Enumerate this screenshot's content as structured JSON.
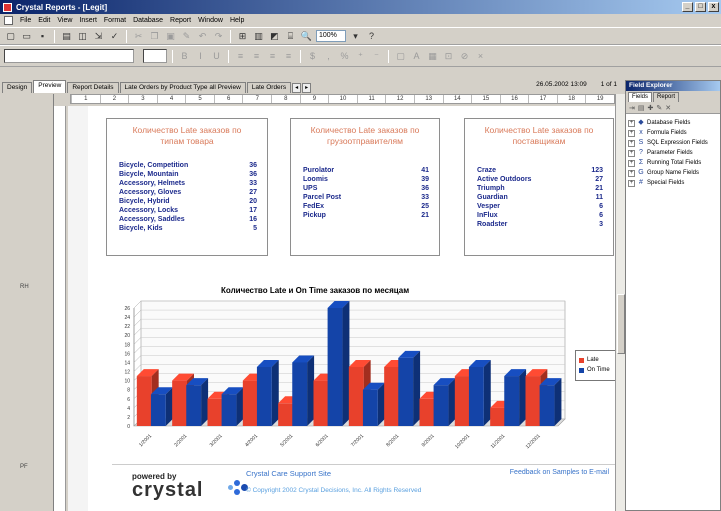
{
  "window": {
    "title": "Crystal Reports - [Legit]",
    "buttons": [
      "_",
      "□",
      "x"
    ]
  },
  "menu": [
    "File",
    "Edit",
    "View",
    "Insert",
    "Format",
    "Database",
    "Report",
    "Window",
    "Help"
  ],
  "toolbar": {
    "zoom": "100%"
  },
  "tabs": [
    {
      "label": "Design",
      "active": false
    },
    {
      "label": "Preview",
      "active": true
    },
    {
      "label": "Report Details",
      "active": false
    },
    {
      "label": "Late Orders by Product Type all Preview",
      "active": false
    },
    {
      "label": "Late Orders",
      "active": false
    }
  ],
  "status": {
    "datetime": "26.05.2002 13:09",
    "page": "1 of 1"
  },
  "ruler": [
    "1",
    "2",
    "3",
    "4",
    "5",
    "6",
    "7",
    "8",
    "9",
    "10",
    "11",
    "12",
    "13",
    "14",
    "15",
    "16",
    "17",
    "18",
    "19"
  ],
  "sections": {
    "rh": "RH",
    "pf": "PF"
  },
  "report": {
    "box1": {
      "title": "Количество Late заказов по типам товара",
      "rows": [
        {
          "name": "Bicycle, Competition",
          "value": "36"
        },
        {
          "name": "Bicycle, Mountain",
          "value": "36"
        },
        {
          "name": "Accessory, Helmets",
          "value": "33"
        },
        {
          "name": "Accessory, Gloves",
          "value": "27"
        },
        {
          "name": "Bicycle, Hybrid",
          "value": "20"
        },
        {
          "name": "Accessory, Locks",
          "value": "17"
        },
        {
          "name": "Accessory, Saddles",
          "value": "16"
        },
        {
          "name": "Bicycle, Kids",
          "value": "5"
        }
      ]
    },
    "box2": {
      "title": "Количество Late заказов по грузоотправителям",
      "rows": [
        {
          "name": "Purolator",
          "value": "41"
        },
        {
          "name": "Loomis",
          "value": "39"
        },
        {
          "name": "UPS",
          "value": "36"
        },
        {
          "name": "Parcel Post",
          "value": "33"
        },
        {
          "name": "FedEx",
          "value": "25"
        },
        {
          "name": "Pickup",
          "value": "21"
        }
      ]
    },
    "box3": {
      "title": "Количество Late заказов по поставщикам",
      "rows": [
        {
          "name": "Craze",
          "value": "123"
        },
        {
          "name": "Active Outdoors",
          "value": "27"
        },
        {
          "name": "Triumph",
          "value": "21"
        },
        {
          "name": "Guardian",
          "value": "11"
        },
        {
          "name": "Vesper",
          "value": "6"
        },
        {
          "name": "InFlux",
          "value": "6"
        },
        {
          "name": "Roadster",
          "value": "3"
        }
      ]
    }
  },
  "chart_data": {
    "type": "bar",
    "title": "Количество Late и On Time заказов по месяцам",
    "categories": [
      "1/2001",
      "2/2001",
      "3/2001",
      "4/2001",
      "5/2001",
      "6/2001",
      "7/2001",
      "8/2001",
      "9/2001",
      "10/2001",
      "11/2001",
      "12/2001"
    ],
    "series": [
      {
        "name": "Late",
        "color": "#e8412c",
        "values": [
          11,
          10,
          6,
          10,
          5,
          10,
          13,
          13,
          6,
          11,
          4,
          11
        ]
      },
      {
        "name": "On Time",
        "color": "#1444a8",
        "values": [
          7,
          9,
          7,
          13,
          14,
          26,
          8,
          15,
          9,
          13,
          11,
          9
        ]
      }
    ],
    "yticks": [
      "0",
      "2",
      "4",
      "6",
      "8",
      "10",
      "12",
      "14",
      "16",
      "18",
      "20",
      "22",
      "24",
      "26"
    ],
    "ylim": [
      0,
      26
    ],
    "legend": "right",
    "grid": true
  },
  "footer": {
    "powered": "powered by",
    "brand": "crystal",
    "support": "Crystal Care Support Site",
    "copyright": "© Copyright 2002 Crystal Decisions, Inc. All Rights Reserved",
    "feedback": "Feedback on Samples to E-mail"
  },
  "explorer": {
    "title": "Field Explorer",
    "tabs": [
      "Fields",
      "Report"
    ],
    "items": [
      {
        "label": "Database Fields",
        "icon": "◆"
      },
      {
        "label": "Formula Fields",
        "icon": "x"
      },
      {
        "label": "SQL Expression Fields",
        "icon": "S"
      },
      {
        "label": "Parameter Fields",
        "icon": "?"
      },
      {
        "label": "Running Total Fields",
        "icon": "Σ"
      },
      {
        "label": "Group Name Fields",
        "icon": "G"
      },
      {
        "label": "Special Fields",
        "icon": "#"
      }
    ]
  }
}
